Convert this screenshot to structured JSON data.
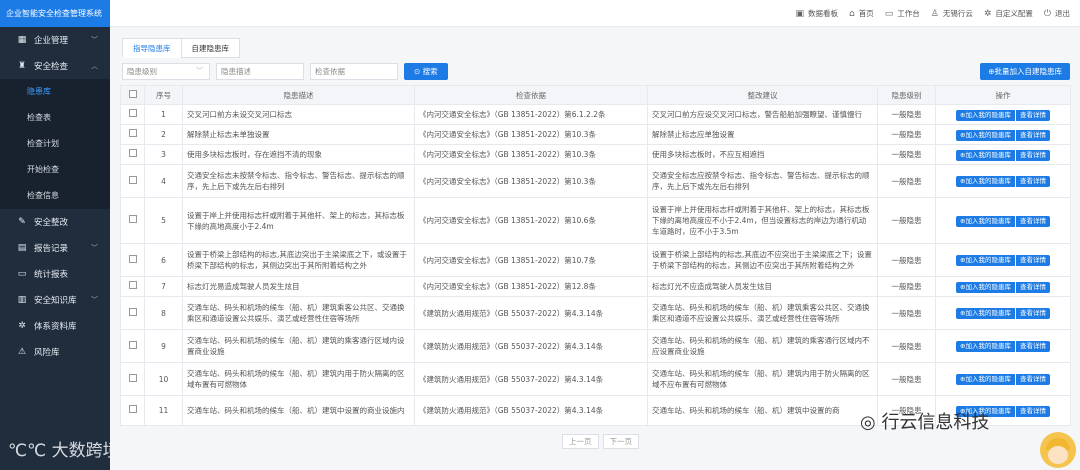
{
  "app": {
    "title": "企业智能安全检查管理系统"
  },
  "header": {
    "actions": [
      {
        "label": "数据看板",
        "icon": "dashboard-icon"
      },
      {
        "label": "首页",
        "icon": "home-icon"
      },
      {
        "label": "工作台",
        "icon": "monitor-icon"
      },
      {
        "label": "无锡行云",
        "icon": "user-icon"
      },
      {
        "label": "自定义配置",
        "icon": "gear-icon"
      },
      {
        "label": "退出",
        "icon": "power-icon"
      }
    ]
  },
  "sidebar": {
    "items": [
      {
        "label": "企业管理",
        "icon": "building-icon"
      },
      {
        "label": "安全检查",
        "icon": "shield-icon"
      },
      {
        "label": "隐患库",
        "sub": true
      },
      {
        "label": "检查表",
        "sub": true
      },
      {
        "label": "检查计划",
        "sub": true
      },
      {
        "label": "开始检查",
        "sub": true
      },
      {
        "label": "检查信息",
        "sub": true
      },
      {
        "label": "安全整改",
        "icon": "tool-icon"
      },
      {
        "label": "报告记录",
        "icon": "report-icon"
      },
      {
        "label": "统计报表",
        "icon": "folder-icon"
      },
      {
        "label": "安全知识库",
        "icon": "book-icon"
      },
      {
        "label": "体系资料库",
        "icon": "gear-icon"
      },
      {
        "label": "风险库",
        "icon": "warning-icon"
      }
    ],
    "watermark": "大数跨境"
  },
  "tabs": [
    "指导隐患库",
    "自建隐患库"
  ],
  "filters": {
    "level_placeholder": "隐患级别",
    "desc_placeholder": "隐患描述",
    "basis_placeholder": "检查依据",
    "search_label": "搜索",
    "batch_label": "⊕批量加入自建隐患库"
  },
  "table": {
    "headers": [
      "",
      "序号",
      "隐患描述",
      "检查依据",
      "整改建议",
      "隐患级别",
      "操作"
    ],
    "rows": [
      {
        "no": "1",
        "desc": "交叉河口前方未设交叉河口标志",
        "basis": "《内河交通安全标志》（GB 13851-2022）第6.1.2.2条",
        "advice": "交叉河口前方应设交叉河口标志，警告船舶加强瞭望、谨慎慢行",
        "level": "一般隐患"
      },
      {
        "no": "2",
        "desc": "解除禁止标志未单独设置",
        "basis": "《内河交通安全标志》（GB 13851-2022）第10.3条",
        "advice": "解除禁止标志应单独设置",
        "level": "一般隐患"
      },
      {
        "no": "3",
        "desc": "使用多块标志板时，存在遮挡不清的现象",
        "basis": "《内河交通安全标志》（GB 13851-2022）第10.3条",
        "advice": "使用多块标志板时，不应互相遮挡",
        "level": "一般隐患"
      },
      {
        "no": "4",
        "desc": "交通安全标志未按禁令标志、指令标志、警告标志、提示标志的顺序，先上后下或先左后右排列",
        "basis": "《内河交通安全标志》（GB 13851-2022）第10.3条",
        "advice": "交通安全标志应按禁令标志、指令标志、警告标志、提示标志的顺序，先上后下或先左后右排列",
        "level": "一般隐患"
      },
      {
        "no": "5",
        "desc": "设置于岸上并使用标志杆或附着于其他杆、架上的标志，其标志板下缘的高地高度小于2.4m",
        "basis": "《内河交通安全标志》（GB 13851-2022）第10.6条",
        "advice": "设置于岸上并使用标志杆或附着于其他杆、架上的标志，其标志板下缘的离地高度应不小于2.4m，但当设置标志的岸边为通行机动车道路时，应不小于3.5m",
        "level": "一般隐患"
      },
      {
        "no": "6",
        "desc": "设置于桥梁上部结构的标志,其底边突出于主梁梁底之下，或设置于桥梁下部结构的标志，其侧边突出于其所附着结构之外",
        "basis": "《内河交通安全标志》（GB 13851-2022）第10.7条",
        "advice": "设置于桥梁上部结构的标志,其底边不应突出于主梁梁底之下；设置于桥梁下部结构的标志，其侧边不应突出于其所附着结构之外",
        "level": "一般隐患"
      },
      {
        "no": "7",
        "desc": "标志灯光易造成驾驶人员发生炫目",
        "basis": "《内河交通安全标志》（GB 13851-2022）第12.8条",
        "advice": "标志灯光不应造成驾驶人员发生炫目",
        "level": "一般隐患"
      },
      {
        "no": "8",
        "desc": "交通车站、码头和机场的候车（船、机）建筑乘客公共区、交通换乘区和通道设置公共娱乐、演艺或经营性住宿等场所",
        "basis": "《建筑防火通用规范》（GB 55037-2022）第4.3.14条",
        "advice": "交通车站、码头和机场的候车（船、机）建筑乘客公共区、交通换乘区和通道不应设置公共娱乐、演艺或经营性住宿等场所",
        "level": "一般隐患"
      },
      {
        "no": "9",
        "desc": "交通车站、码头和机场的候车（船、机）建筑的乘客通行区域内设置商业设施",
        "basis": "《建筑防火通用规范》（GB 55037-2022）第4.3.14条",
        "advice": "交通车站、码头和机场的候车（船、机）建筑的乘客通行区域内不应设置商业设施",
        "level": "一般隐患"
      },
      {
        "no": "10",
        "desc": "交通车站、码头和机场的候车（船、机）建筑内用于防火隔离的区域布置有可燃物体",
        "basis": "《建筑防火通用规范》（GB 55037-2022）第4.3.14条",
        "advice": "交通车站、码头和机场的候车（船、机）建筑内用于防火隔离的区域不应布置有可燃物体",
        "level": "一般隐患"
      },
      {
        "no": "11",
        "desc": "交通车站、码头和机场的候车（船、机）建筑中设置的商业设施内",
        "basis": "《建筑防火通用规范》（GB 55037-2022）第4.3.14条",
        "advice": "交通车站、码头和机场的候车（船、机）建筑中设置的商",
        "level": "一般隐患"
      }
    ],
    "row_action_add": "⊕加入我的隐患库",
    "row_action_view": "查看详情"
  },
  "pager": {
    "prev": "上一页",
    "next": "下一页"
  },
  "watermark_right": "行云信息科技"
}
